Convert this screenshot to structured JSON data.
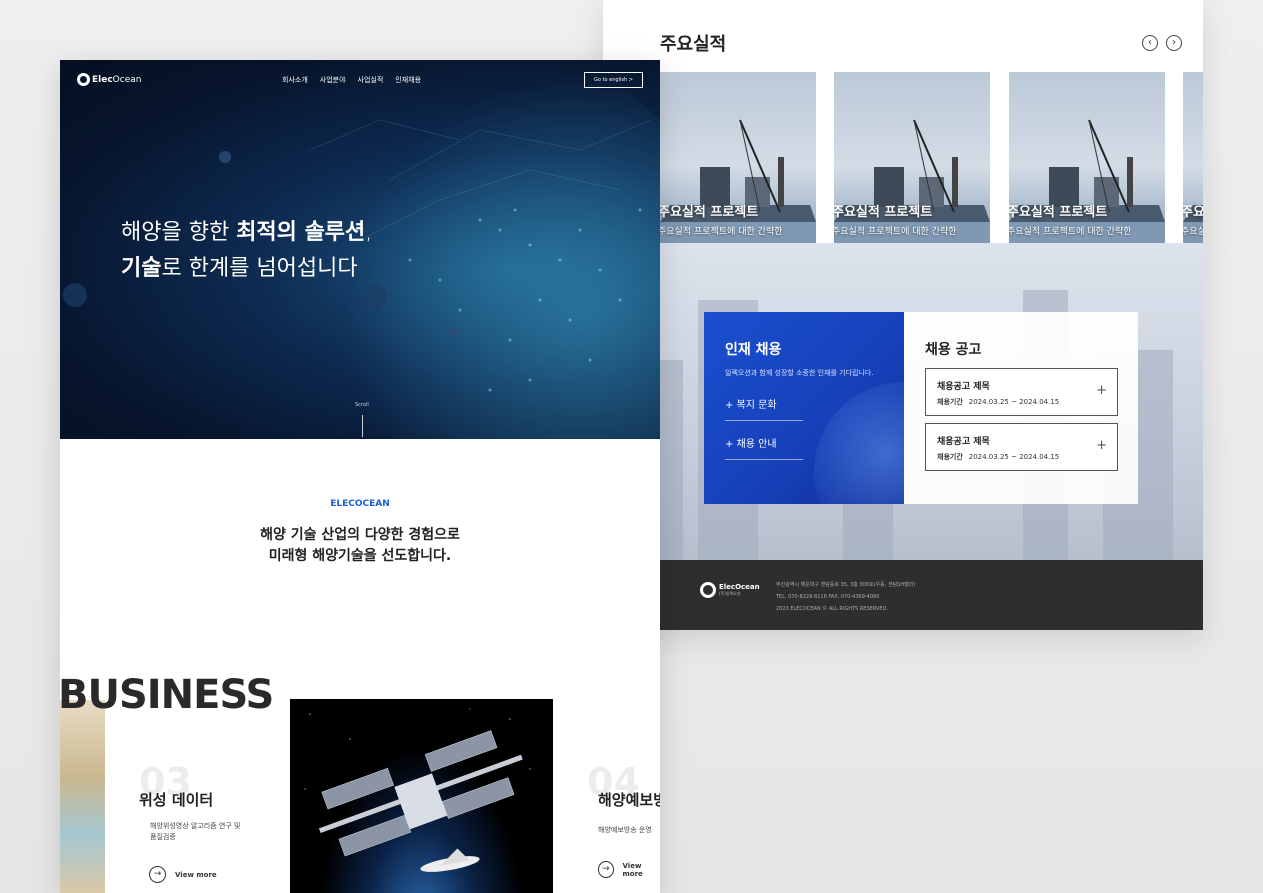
{
  "right_panel": {
    "section_title": "주요실적",
    "prev_icon": "chevron-left-icon",
    "next_icon": "chevron-right-icon",
    "cards": [
      {
        "title": "주요실적 프로젝트",
        "desc": "주요실적 프로젝트에 대한 간략한"
      },
      {
        "title": "주요실적 프로젝트",
        "desc": "주요실적 프로젝트에 대한 간략한"
      },
      {
        "title": "주요실적 프로젝트",
        "desc": "주요실적 프로젝트에 대한 간략한"
      },
      {
        "title": "주요실적 프로젝트",
        "desc": "주요실적 프로젝트에 대한 간략한"
      }
    ],
    "recruit": {
      "title": "인재 채용",
      "desc": "일렉오션과 함께 성장할 소중한 인재를 기다립니다.",
      "links": [
        "+ 복지 문화",
        "+ 채용 안내"
      ]
    },
    "jobs": {
      "title": "채용 공고",
      "items": [
        {
          "title": "채용공고 제목",
          "period_label": "채용기간",
          "period": "2024.03.25 ~ 2024.04.15"
        },
        {
          "title": "채용공고 제목",
          "period_label": "채용기간",
          "period": "2024.03.25 ~ 2024.04.15"
        }
      ]
    },
    "footer": {
      "logo_main": "ElecOcean",
      "logo_sub": "(주)일렉오션",
      "address": "부산광역시 해운대구 센텀동로 35, 3층 308호(우동, 센텀SH밸리)",
      "contact": "TEL. 070-8228-8116   FAX. 070-4369-4080",
      "copyright": "2023 ELECOCEAN © ALL RIGHTS RESERVED."
    }
  },
  "left_panel": {
    "logo_text": "Elec",
    "logo_text2": "Ocean",
    "nav": [
      "회사소개",
      "사업분야",
      "사업실적",
      "인재채용"
    ],
    "english_button": "Go to english  >",
    "hero_line1_a": "해양을 향한 ",
    "hero_line1_b": "최적의 솔루션",
    "hero_line1_c": ",",
    "hero_line2_a": "기술",
    "hero_line2_b": "로 한계를 넘어섭니다",
    "scroll_label": "Scroll",
    "brand_label": "ELECOCEAN",
    "intro_line1": "해양 기술 산업의 다양한 경험으로",
    "intro_line2": "미래형 해양기술을 선도합니다.",
    "business_title": "BUSINESS",
    "business_cards": [
      {
        "num": "03",
        "title": "위성 데이터",
        "desc_line1": "해양위성영상 알고리즘 연구 및",
        "desc_line2": "품질검증",
        "more": "View more"
      },
      {
        "num": "04",
        "title": "해양예보방",
        "desc_line1": "해양예보방송 운영",
        "desc_line2": "",
        "more": "View more"
      }
    ]
  },
  "colors": {
    "accent": "#1a5ed8",
    "hero_bg": "#07152d",
    "footer_bg": "#2e2e2e"
  }
}
